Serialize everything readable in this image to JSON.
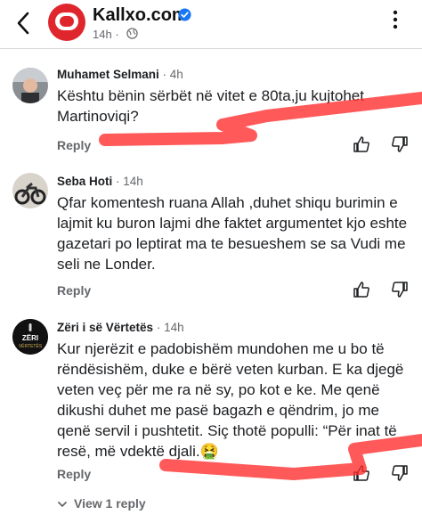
{
  "header": {
    "page_name": "Kallxo.com",
    "time": "14h",
    "separator": "·"
  },
  "comments": [
    {
      "author": "Muhamet Selmani",
      "time": "· 4h",
      "text": "Kështu bënin sërbët në vitet e 80ta,ju kujtohet Martinoviqi?",
      "reply_label": "Reply"
    },
    {
      "author": "Seba Hoti",
      "time": "· 14h",
      "text": "Qfar komentesh ruana Allah ,duhet shiqu burimin e lajmit ku buron lajmi dhe faktet argumentet kjo eshte gazetari po leptirat ma te besueshem se sa Vudi me seli ne Londer.",
      "reply_label": "Reply"
    },
    {
      "author": "Zëri i së Vërtetës",
      "time": "· 14h",
      "text": "Kur njerëzit e padobishëm mundohen me u bo të rëndësishëm, duke e bërë veten kurban. E ka djegë veten veç për me ra në sy, po kot e ke. Me qenë dikushi duhet me pasë bagazh e qëndrim, jo me qenë servil i pushtetit. Siç thotë populli: “Për inat të resë, më vdektë djali.🤮",
      "reply_label": "Reply",
      "avatar_text_top": "ZËRI",
      "avatar_text_bottom": "VËRTETËS",
      "view_replies": "View 1 reply"
    }
  ],
  "icons": {
    "back": "chevron-left-icon",
    "verified": "verified-badge-icon",
    "globe": "globe-icon",
    "more": "more-vertical-icon",
    "upvote": "thumbs-up-icon",
    "downvote": "thumbs-down-icon",
    "expand": "chevron-down-icon"
  },
  "colors": {
    "brand_red": "#e0262d",
    "verified_blue": "#1877f2",
    "secondary_text": "#65676b",
    "scribble_red": "#ff2a2a"
  }
}
